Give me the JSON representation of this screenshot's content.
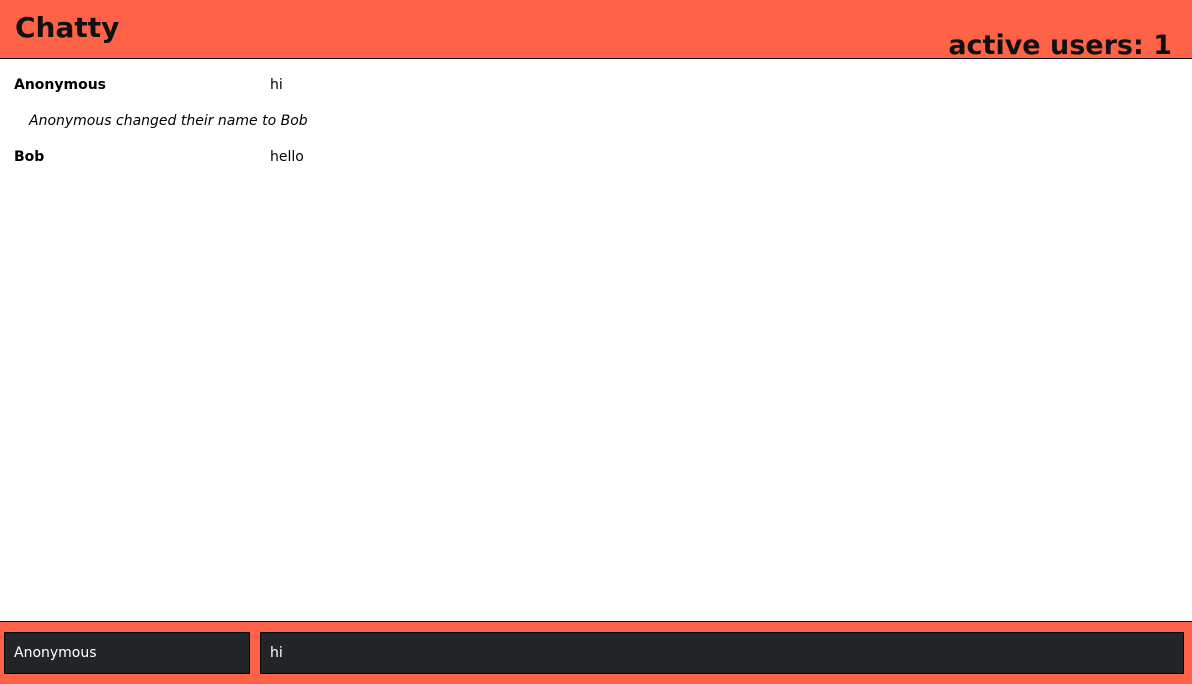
{
  "app": {
    "title": "Chatty",
    "user_count_text": "active users: 1"
  },
  "colors": {
    "accent": "#ff6347",
    "input_background": "#222528",
    "text": "#000000"
  },
  "messages": [
    {
      "type": "message",
      "username": "Anonymous",
      "content": "hi"
    },
    {
      "type": "notification",
      "content": "Anonymous changed their name to Bob"
    },
    {
      "type": "message",
      "username": "Bob",
      "content": "hello"
    }
  ],
  "chatbar": {
    "username_value": "Anonymous",
    "message_value": "hi"
  }
}
